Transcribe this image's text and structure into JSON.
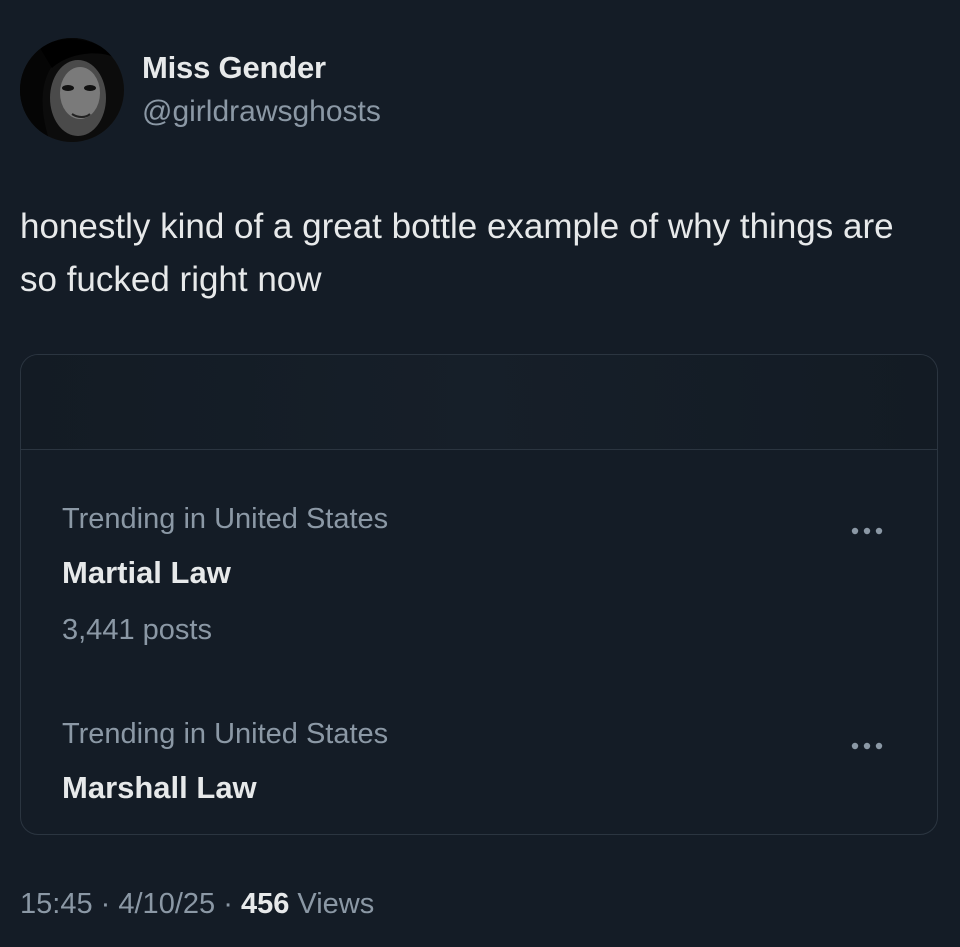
{
  "author": {
    "name": "Miss Gender",
    "handle": "@girldrawsghosts"
  },
  "tweet": {
    "text": "honestly kind of a great bottle example of why things are so fucked right now"
  },
  "quoted_trends": [
    {
      "context": "Trending in United States",
      "name": "Martial Law",
      "posts": "3,441 posts",
      "more_icon": "more-horizontal-icon"
    },
    {
      "context": "Trending in United States",
      "name": "Marshall Law",
      "more_icon": "more-horizontal-icon"
    }
  ],
  "meta": {
    "time": "15:45",
    "separator": "·",
    "date": "4/10/25",
    "views_count": "456",
    "views_label": "Views"
  },
  "colors": {
    "background": "#141c26",
    "primary_text": "#e7e9ea",
    "secondary_text": "#8b98a5",
    "border": "#2b3540"
  }
}
